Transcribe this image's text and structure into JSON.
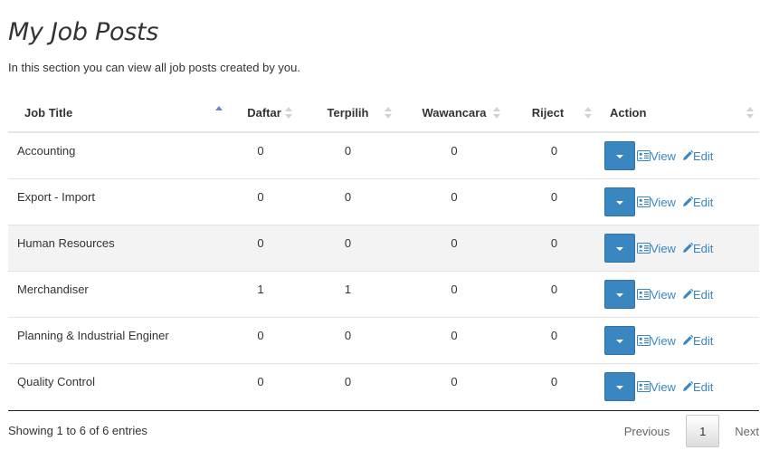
{
  "page": {
    "title": "My Job Posts",
    "subtitle": "In this section you can view all job posts created by you."
  },
  "table": {
    "columns": [
      "Job Title",
      "Daftar",
      "Terpilih",
      "Wawancara",
      "Riject",
      "Action"
    ],
    "sorted_column": "Job Title",
    "sort_direction": "ascending",
    "rows": [
      {
        "title": "Accounting",
        "daftar": "0",
        "terpilih": "0",
        "wawancara": "0",
        "riject": "0"
      },
      {
        "title": "Export - Import",
        "daftar": "0",
        "terpilih": "0",
        "wawancara": "0",
        "riject": "0"
      },
      {
        "title": "Human Resources",
        "daftar": "0",
        "terpilih": "0",
        "wawancara": "0",
        "riject": "0"
      },
      {
        "title": "Merchandiser",
        "daftar": "1",
        "terpilih": "1",
        "wawancara": "0",
        "riject": "0"
      },
      {
        "title": "Planning & Industrial Enginer",
        "daftar": "0",
        "terpilih": "0",
        "wawancara": "0",
        "riject": "0"
      },
      {
        "title": "Quality Control",
        "daftar": "0",
        "terpilih": "0",
        "wawancara": "0",
        "riject": "0"
      }
    ],
    "actions": {
      "view_label": "View",
      "edit_label": "Edit"
    }
  },
  "footer": {
    "info": "Showing 1 to 6 of 6 entries",
    "pagination": {
      "previous": "Previous",
      "current_page": "1",
      "next": "Next"
    }
  },
  "colors": {
    "accent": "#3a86c0",
    "sort_active": "#6b7fd6",
    "stripe": "#f3f3f3"
  },
  "icons": [
    "sort-arrows-icon",
    "caret-down-icon",
    "id-card-icon",
    "pencil-icon"
  ]
}
